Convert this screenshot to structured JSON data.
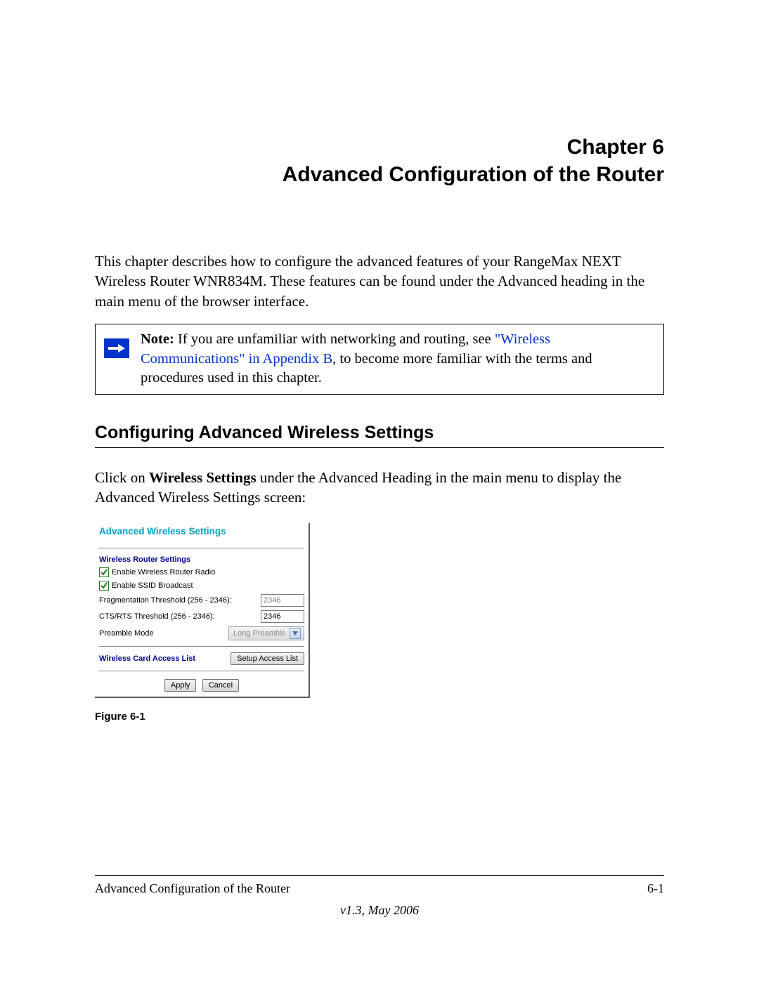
{
  "chapter": {
    "number_line": "Chapter 6",
    "title_line": "Advanced Configuration of the Router"
  },
  "intro": "This chapter describes how to configure the advanced features of your RangeMax NEXT Wireless Router WNR834M. These features can be found under the Advanced heading in the main menu of the browser interface.",
  "note": {
    "label": "Note:",
    "text_before_link": " If you are unfamiliar with networking and routing, see ",
    "link_text": "\"Wireless Communications\" in Appendix B",
    "text_after_link": ", to become more familiar with the terms and procedures used in this chapter."
  },
  "section": {
    "heading": "Configuring Advanced Wireless Settings",
    "para_before_bold": "Click on ",
    "para_bold": "Wireless Settings",
    "para_after_bold": " under the Advanced Heading in the main menu to display the Advanced Wireless Settings screen:"
  },
  "panel": {
    "title": "Advanced Wireless Settings",
    "router_section": "Wireless Router Settings",
    "enable_radio": "Enable Wireless Router Radio",
    "enable_ssid": "Enable SSID Broadcast",
    "frag_label": "Fragmentation Threshold (256 - 2346):",
    "frag_value": "2346",
    "cts_label": "CTS/RTS Threshold (256 - 2346):",
    "cts_value": "2346",
    "preamble_label": "Preamble Mode",
    "preamble_value": "Long Preamble",
    "access_list_label": "Wireless Card Access List",
    "setup_access_btn": "Setup Access List",
    "apply_btn": "Apply",
    "cancel_btn": "Cancel"
  },
  "figure_caption": "Figure 6-1",
  "footer": {
    "left": "Advanced Configuration of the Router",
    "right": "6-1",
    "version": "v1.3, May 2006"
  }
}
